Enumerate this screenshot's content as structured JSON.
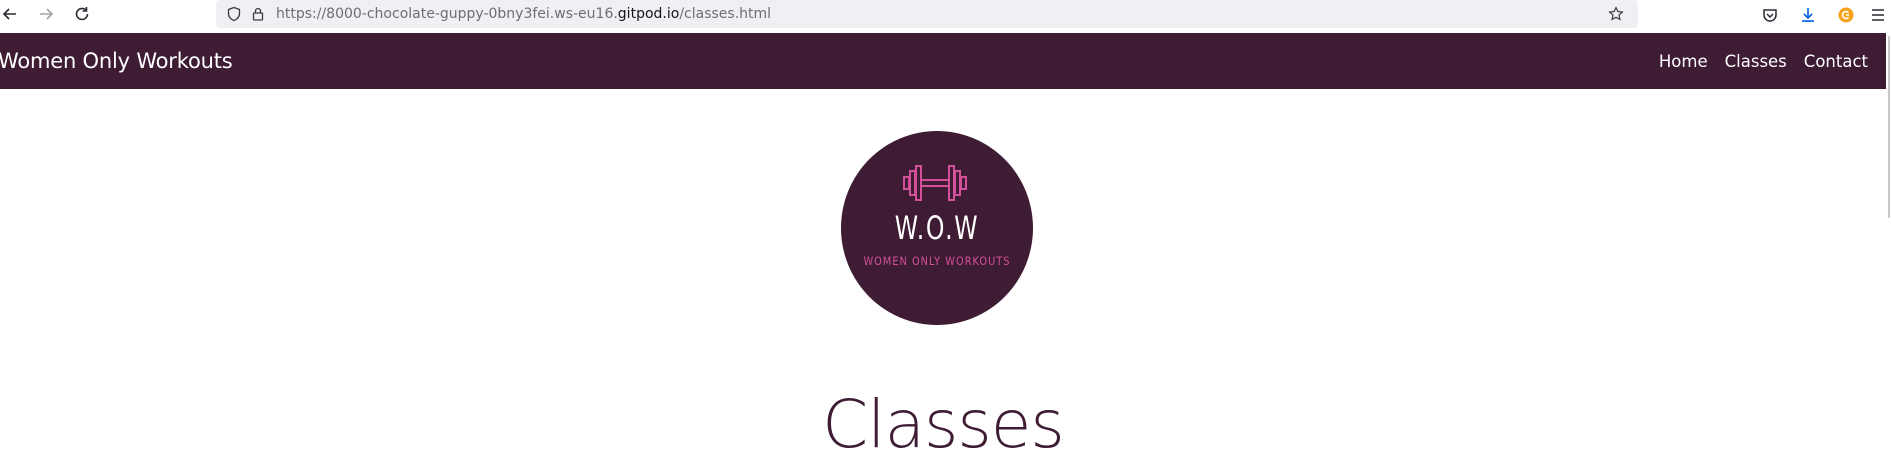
{
  "browser": {
    "url_prefix": "https://8000-chocolate-guppy-0bny3fei.ws-eu16.",
    "url_host": "gitpod.io",
    "url_suffix": "/classes.html"
  },
  "navbar": {
    "brand": "Women Only Workouts",
    "links": [
      "Home",
      "Classes",
      "Contact"
    ]
  },
  "logo": {
    "title": "W.O.W",
    "subtitle": "WOMEN ONLY WORKOUTS"
  },
  "main": {
    "heading": "Classes"
  },
  "colors": {
    "brand_dark": "#3e1c33",
    "brand_pink": "#d4509b"
  },
  "icons": [
    "back-arrow-icon",
    "forward-arrow-icon",
    "reload-icon",
    "shield-icon",
    "lock-icon",
    "star-icon",
    "pocket-icon",
    "download-icon",
    "extension-icon",
    "menu-icon",
    "dumbbell-icon"
  ]
}
